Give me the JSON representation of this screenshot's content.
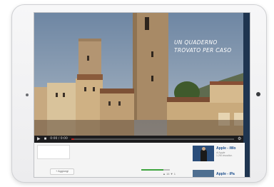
{
  "video": {
    "overlay_title": "Un quaderno trovato per caso",
    "time": "0:00 / 0:00",
    "progress": 0.02
  },
  "below": {
    "action_label": "+ Aggiungi",
    "views_bar_fill": 0.78,
    "likes": "▲ 15  ▼ 1"
  },
  "related": [
    {
      "title": "Apple - iWo",
      "meta": "di Apple\n1.2M visualizz."
    },
    {
      "title": "Apple - iPa"
    }
  ],
  "colors": {
    "controls_bg": "#1c1c1e",
    "progress_red": "#b92b27",
    "link_blue": "#1a4d8c",
    "views_green": "#3ea43e"
  }
}
